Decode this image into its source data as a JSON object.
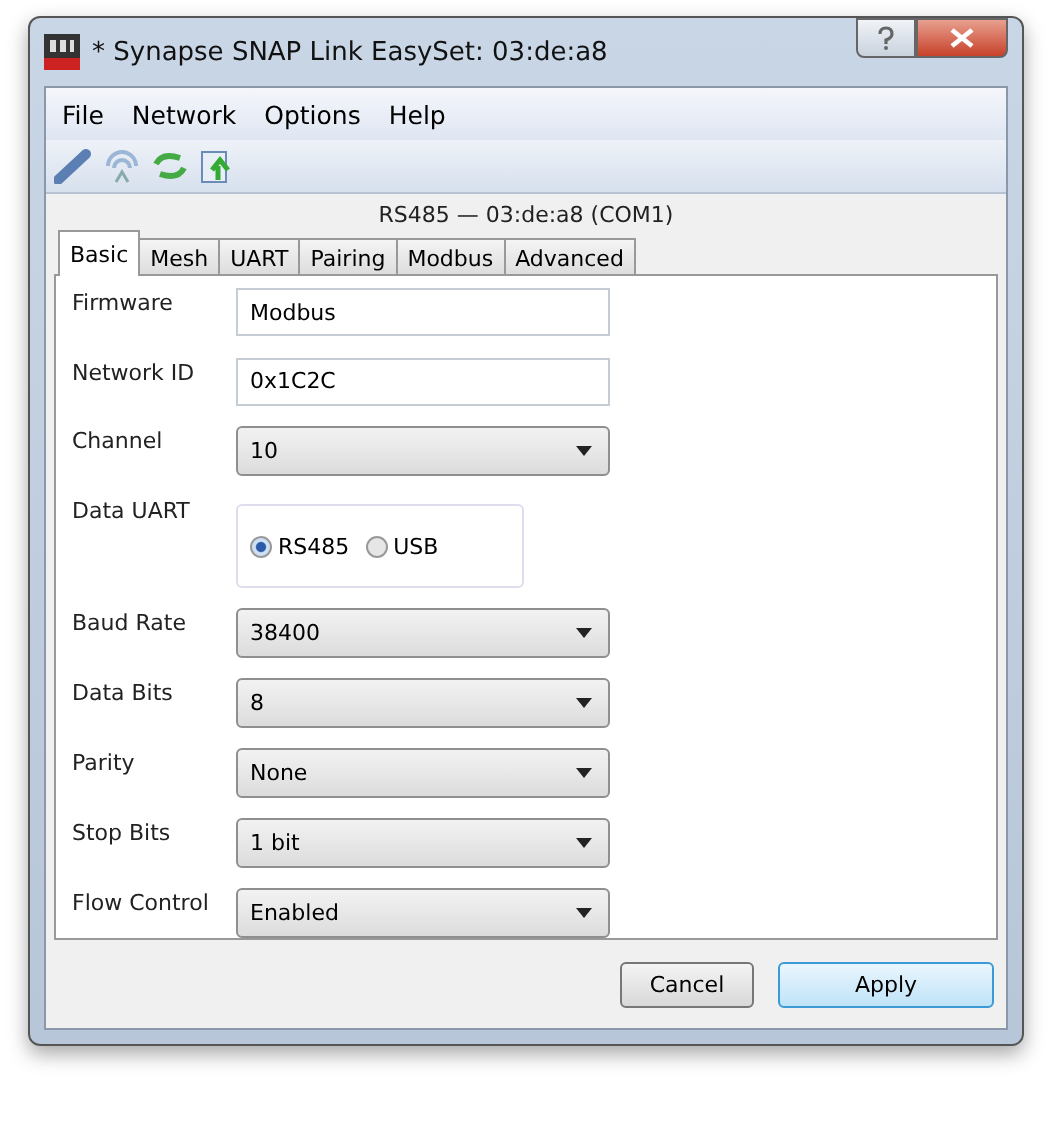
{
  "window": {
    "title": "* Synapse SNAP Link EasySet: 03:de:a8"
  },
  "menu": [
    "File",
    "Network",
    "Options",
    "Help"
  ],
  "device_header": "RS485 — 03:de:a8 (COM1)",
  "tabs": [
    {
      "label": "Basic",
      "selected": true
    },
    {
      "label": "Mesh",
      "selected": false
    },
    {
      "label": "UART",
      "selected": false
    },
    {
      "label": "Pairing",
      "selected": false
    },
    {
      "label": "Modbus",
      "selected": false
    },
    {
      "label": "Advanced",
      "selected": false
    }
  ],
  "fields": [
    {
      "kind": "text",
      "label": "Firmware",
      "value": "Modbus"
    },
    {
      "kind": "text",
      "label": "Network ID",
      "value": "0x1C2C"
    },
    {
      "kind": "dropdown",
      "label": "Channel",
      "value": "10"
    },
    {
      "kind": "radio",
      "label": "Data UART",
      "options": [
        {
          "label": "RS485",
          "selected": true
        },
        {
          "label": "USB",
          "selected": false
        }
      ]
    },
    {
      "kind": "dropdown",
      "label": "Baud Rate",
      "value": "38400"
    },
    {
      "kind": "dropdown",
      "label": "Data Bits",
      "value": "8"
    },
    {
      "kind": "dropdown",
      "label": "Parity",
      "value": "None"
    },
    {
      "kind": "dropdown",
      "label": "Stop Bits",
      "value": "1 bit"
    },
    {
      "kind": "dropdown",
      "label": "Flow Control",
      "value": "Enabled"
    }
  ],
  "buttons": [
    {
      "label": "Cancel",
      "default": false
    },
    {
      "label": "Apply",
      "default": true
    }
  ]
}
